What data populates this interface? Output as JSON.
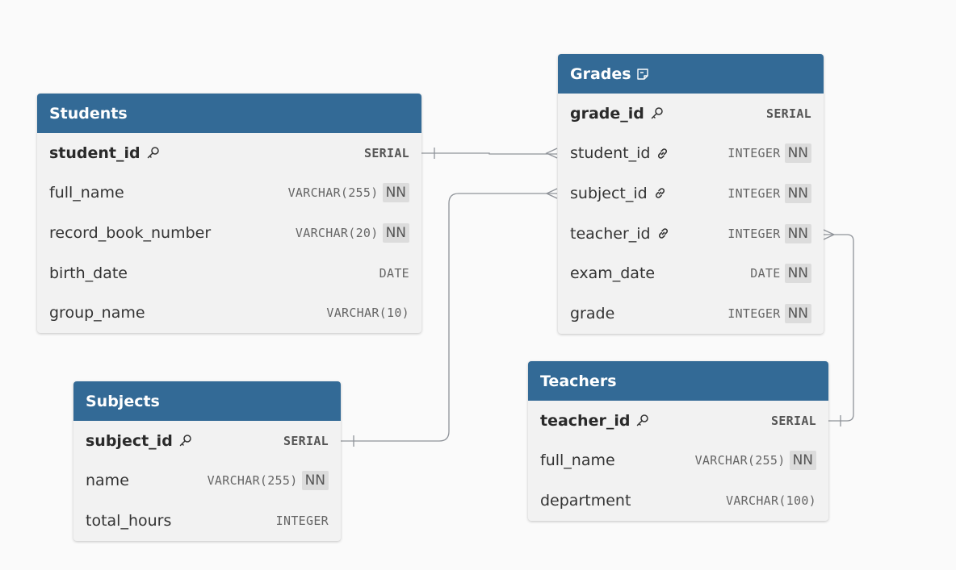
{
  "tables": {
    "students": {
      "title": "Students",
      "columns": [
        {
          "name": "student_id",
          "type": "SERIAL",
          "nn": "",
          "key": "pk"
        },
        {
          "name": "full_name",
          "type": "VARCHAR(255)",
          "nn": "NN",
          "key": ""
        },
        {
          "name": "record_book_number",
          "type": "VARCHAR(20)",
          "nn": "NN",
          "key": ""
        },
        {
          "name": "birth_date",
          "type": "DATE",
          "nn": "",
          "key": ""
        },
        {
          "name": "group_name",
          "type": "VARCHAR(10)",
          "nn": "",
          "key": ""
        }
      ]
    },
    "grades": {
      "title": "Grades",
      "has_note": true,
      "columns": [
        {
          "name": "grade_id",
          "type": "SERIAL",
          "nn": "",
          "key": "pk"
        },
        {
          "name": "student_id",
          "type": "INTEGER",
          "nn": "NN",
          "key": "fk"
        },
        {
          "name": "subject_id",
          "type": "INTEGER",
          "nn": "NN",
          "key": "fk"
        },
        {
          "name": "teacher_id",
          "type": "INTEGER",
          "nn": "NN",
          "key": "fk"
        },
        {
          "name": "exam_date",
          "type": "DATE",
          "nn": "NN",
          "key": ""
        },
        {
          "name": "grade",
          "type": "INTEGER",
          "nn": "NN",
          "key": ""
        }
      ]
    },
    "subjects": {
      "title": "Subjects",
      "columns": [
        {
          "name": "subject_id",
          "type": "SERIAL",
          "nn": "",
          "key": "pk"
        },
        {
          "name": "name",
          "type": "VARCHAR(255)",
          "nn": "NN",
          "key": ""
        },
        {
          "name": "total_hours",
          "type": "INTEGER",
          "nn": "",
          "key": ""
        }
      ]
    },
    "teachers": {
      "title": "Teachers",
      "columns": [
        {
          "name": "teacher_id",
          "type": "SERIAL",
          "nn": "",
          "key": "pk"
        },
        {
          "name": "full_name",
          "type": "VARCHAR(255)",
          "nn": "NN",
          "key": ""
        },
        {
          "name": "department",
          "type": "VARCHAR(100)",
          "nn": "",
          "key": ""
        }
      ]
    }
  },
  "relationships": [
    {
      "from": "students.student_id",
      "to": "grades.student_id",
      "cardinality": "one-to-many"
    },
    {
      "from": "subjects.subject_id",
      "to": "grades.subject_id",
      "cardinality": "one-to-many"
    },
    {
      "from": "teachers.teacher_id",
      "to": "grades.teacher_id",
      "cardinality": "one-to-many"
    }
  ],
  "colors": {
    "header": "#336a96",
    "table_body": "#f2f2f2",
    "canvas": "#fafafa",
    "connector": "#8f9399",
    "nn_badge": "#dcdcdc"
  },
  "icons": {
    "primary_key": "key-icon",
    "foreign_key": "link-icon",
    "table_note": "note-icon"
  }
}
